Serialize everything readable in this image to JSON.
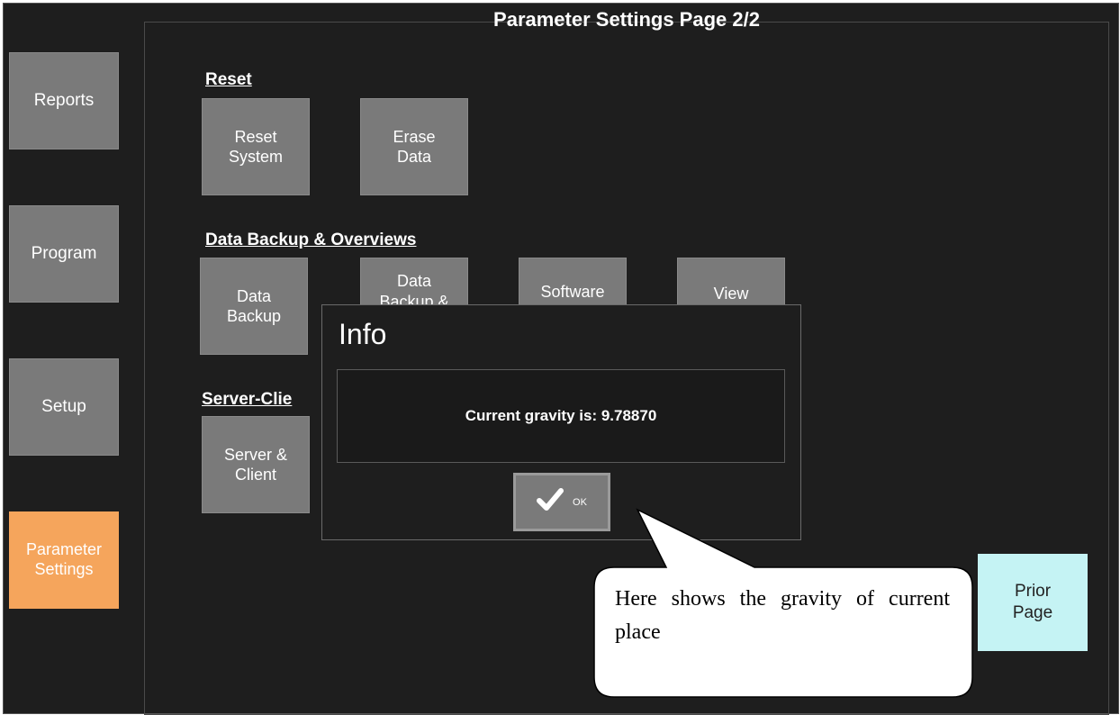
{
  "header": {
    "title": "Parameter Settings Page 2/2"
  },
  "nav": {
    "items": [
      {
        "label": "Reports"
      },
      {
        "label": "Program"
      },
      {
        "label": "Setup"
      },
      {
        "label": "Parameter\nSettings",
        "active": true
      }
    ]
  },
  "sections": {
    "reset": {
      "heading": "Reset",
      "buttons": [
        {
          "label": "Reset\nSystem"
        },
        {
          "label": "Erase\nData"
        }
      ]
    },
    "backup": {
      "heading": "Data Backup & Overviews",
      "buttons": [
        {
          "label": "Data\nBackup"
        },
        {
          "label": "Data\nBackup &"
        },
        {
          "label": "Software"
        },
        {
          "label": "View"
        }
      ]
    },
    "server": {
      "heading": "Server-Clie",
      "buttons": [
        {
          "label": "Server &\nClient"
        }
      ]
    }
  },
  "prior_page": {
    "label": "Prior\nPage"
  },
  "dialog": {
    "title": "Info",
    "message": "Current gravity is: 9.78870",
    "ok_label": "OK",
    "ok_icon": "checkmark-icon"
  },
  "callout": {
    "text": "Here shows the gravity of current place"
  },
  "colors": {
    "background": "#1e1e1e",
    "button": "#7a7a7a",
    "active": "#f5a55c",
    "prior_page": "#c5f3f4"
  }
}
